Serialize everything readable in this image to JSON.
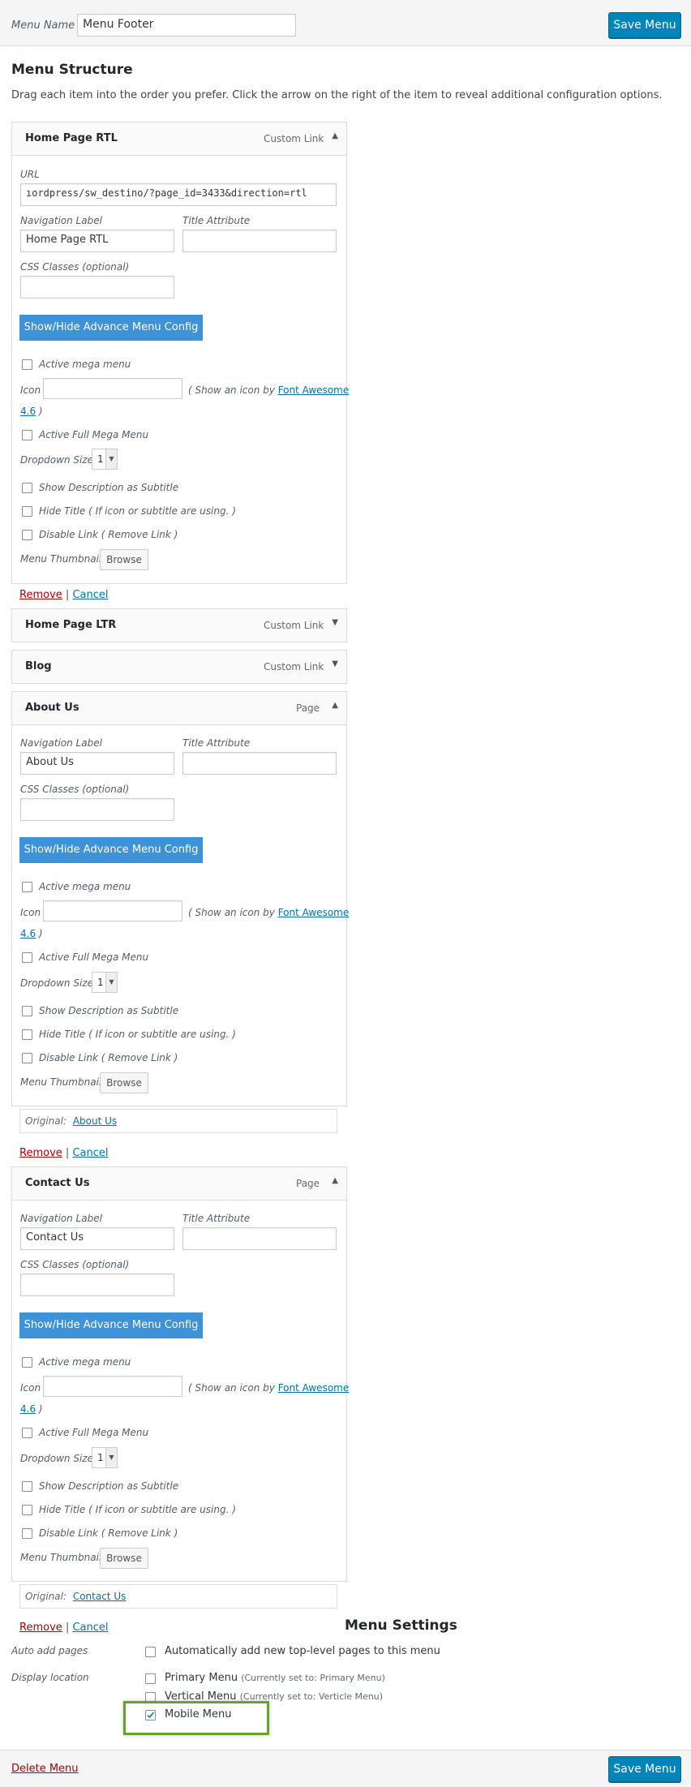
{
  "header": {
    "menu_name_label": "Menu Name",
    "menu_name_value": "Menu Footer",
    "save_label": "Save Menu"
  },
  "structure": {
    "title": "Menu Structure",
    "instructions": "Drag each item into the order you prefer. Click the arrow on the right of the item to reveal additional configuration options."
  },
  "labels": {
    "url": "URL",
    "nav_label": "Navigation Label",
    "title_attr": "Title Attribute",
    "css_classes": "CSS Classes (optional)",
    "adv_button": "Show/Hide Advance Menu Config",
    "active_mega": "Active mega menu",
    "icon": "Icon",
    "show_icon_prefix": "( Show an icon by ",
    "font_awesome": "Font Awesome",
    "fa_version": "4.6",
    "close_paren": " )",
    "active_full_mega": "Active Full Mega Menu",
    "dropdown_size": "Dropdown Size",
    "dropdown_value": "1",
    "show_desc": "Show Description as Subtitle",
    "hide_title": "Hide Title ( If icon or subtitle are using. )",
    "disable_link": "Disable Link ( Remove Link )",
    "menu_thumbnail": "Menu Thumbnail",
    "browse": "Browse",
    "original": "Original:",
    "remove": "Remove",
    "separator": "|",
    "cancel": "Cancel"
  },
  "items": [
    {
      "title": "Home Page RTL",
      "type": "Custom Link",
      "url": "ıordpress/sw_destino/?page_id=3433&direction=rtl",
      "nav_label": "Home Page RTL"
    },
    {
      "title": "Home Page LTR",
      "type": "Custom Link"
    },
    {
      "title": "Blog",
      "type": "Custom Link"
    },
    {
      "title": "About Us",
      "type": "Page",
      "nav_label": "About Us",
      "original": "About Us"
    },
    {
      "title": "Contact Us",
      "type": "Page",
      "nav_label": "Contact Us",
      "original": "Contact Us"
    }
  ],
  "menu_settings": {
    "title": "Menu Settings",
    "auto_add_label": "Auto add pages",
    "auto_add_text": "Automatically add new top-level pages to this menu",
    "display_location_label": "Display location",
    "locations": [
      {
        "name": "Primary Menu",
        "note": "(Currently set to: Primary Menu)",
        "checked": false
      },
      {
        "name": "Vertical Menu",
        "note": "(Currently set to: Verticle Menu)",
        "checked": false
      },
      {
        "name": "Mobile Menu",
        "note": "",
        "checked": true
      }
    ]
  },
  "footer": {
    "delete_label": "Delete Menu",
    "save_label": "Save Menu"
  },
  "colors": {
    "primary_button": "#0085ba",
    "advance_button": "#3e92d8",
    "highlight": "#66a22e",
    "remove_link": "#aa0000"
  }
}
